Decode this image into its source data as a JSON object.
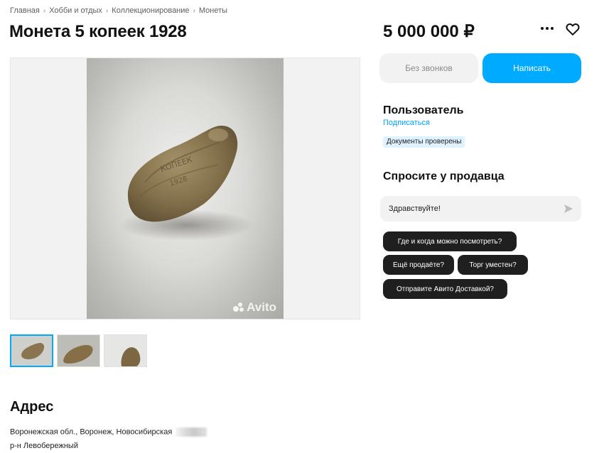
{
  "breadcrumbs": [
    "Главная",
    "Хобби и отдых",
    "Коллекционирование",
    "Монеты"
  ],
  "listing": {
    "title": "Монета 5 копеек 1928",
    "price": "5 000 000 ₽"
  },
  "gallery": {
    "watermark": "Avito",
    "thumbnail_count": 3,
    "active_thumbnail": 1
  },
  "actions": {
    "no_calls_label": "Без звонков",
    "write_label": "Написать"
  },
  "seller": {
    "name": "Пользователь",
    "subscribe_label": "Подписаться",
    "documents_badge": "Документы проверены"
  },
  "ask_seller": {
    "heading": "Спросите у продавца",
    "message_value": "Здравствуйте!",
    "quick_questions": [
      "Где и когда можно посмотреть?",
      "Ещё продаёте?",
      "Торг уместен?",
      "Отправите Авито Доставкой?"
    ]
  },
  "address": {
    "heading": "Адрес",
    "line1": "Воронежская обл., Воронеж, Новосибирская",
    "line2": "р-н Левобережный"
  },
  "colors": {
    "accent": "#00aaff",
    "badge_bg": "#dff2ff",
    "chip_bg": "#1f1f1f",
    "link": "#00a3ff"
  },
  "icons": {
    "more": "more-horizontal-icon",
    "favorite": "heart-outline-icon",
    "send": "send-arrow-icon"
  }
}
